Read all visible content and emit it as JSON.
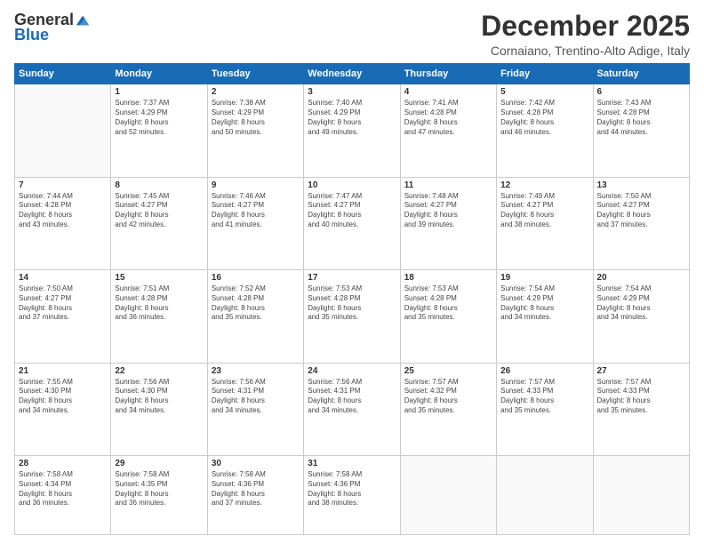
{
  "logo": {
    "general": "General",
    "blue": "Blue"
  },
  "title": "December 2025",
  "location": "Cornaiano, Trentino-Alto Adige, Italy",
  "days_header": [
    "Sunday",
    "Monday",
    "Tuesday",
    "Wednesday",
    "Thursday",
    "Friday",
    "Saturday"
  ],
  "weeks": [
    [
      {
        "day": "",
        "info": ""
      },
      {
        "day": "1",
        "info": "Sunrise: 7:37 AM\nSunset: 4:29 PM\nDaylight: 8 hours\nand 52 minutes."
      },
      {
        "day": "2",
        "info": "Sunrise: 7:38 AM\nSunset: 4:29 PM\nDaylight: 8 hours\nand 50 minutes."
      },
      {
        "day": "3",
        "info": "Sunrise: 7:40 AM\nSunset: 4:29 PM\nDaylight: 8 hours\nand 49 minutes."
      },
      {
        "day": "4",
        "info": "Sunrise: 7:41 AM\nSunset: 4:28 PM\nDaylight: 8 hours\nand 47 minutes."
      },
      {
        "day": "5",
        "info": "Sunrise: 7:42 AM\nSunset: 4:28 PM\nDaylight: 8 hours\nand 46 minutes."
      },
      {
        "day": "6",
        "info": "Sunrise: 7:43 AM\nSunset: 4:28 PM\nDaylight: 8 hours\nand 44 minutes."
      }
    ],
    [
      {
        "day": "7",
        "info": "Sunrise: 7:44 AM\nSunset: 4:28 PM\nDaylight: 8 hours\nand 43 minutes."
      },
      {
        "day": "8",
        "info": "Sunrise: 7:45 AM\nSunset: 4:27 PM\nDaylight: 8 hours\nand 42 minutes."
      },
      {
        "day": "9",
        "info": "Sunrise: 7:46 AM\nSunset: 4:27 PM\nDaylight: 8 hours\nand 41 minutes."
      },
      {
        "day": "10",
        "info": "Sunrise: 7:47 AM\nSunset: 4:27 PM\nDaylight: 8 hours\nand 40 minutes."
      },
      {
        "day": "11",
        "info": "Sunrise: 7:48 AM\nSunset: 4:27 PM\nDaylight: 8 hours\nand 39 minutes."
      },
      {
        "day": "12",
        "info": "Sunrise: 7:49 AM\nSunset: 4:27 PM\nDaylight: 8 hours\nand 38 minutes."
      },
      {
        "day": "13",
        "info": "Sunrise: 7:50 AM\nSunset: 4:27 PM\nDaylight: 8 hours\nand 37 minutes."
      }
    ],
    [
      {
        "day": "14",
        "info": "Sunrise: 7:50 AM\nSunset: 4:27 PM\nDaylight: 8 hours\nand 37 minutes."
      },
      {
        "day": "15",
        "info": "Sunrise: 7:51 AM\nSunset: 4:28 PM\nDaylight: 8 hours\nand 36 minutes."
      },
      {
        "day": "16",
        "info": "Sunrise: 7:52 AM\nSunset: 4:28 PM\nDaylight: 8 hours\nand 35 minutes."
      },
      {
        "day": "17",
        "info": "Sunrise: 7:53 AM\nSunset: 4:28 PM\nDaylight: 8 hours\nand 35 minutes."
      },
      {
        "day": "18",
        "info": "Sunrise: 7:53 AM\nSunset: 4:28 PM\nDaylight: 8 hours\nand 35 minutes."
      },
      {
        "day": "19",
        "info": "Sunrise: 7:54 AM\nSunset: 4:29 PM\nDaylight: 8 hours\nand 34 minutes."
      },
      {
        "day": "20",
        "info": "Sunrise: 7:54 AM\nSunset: 4:29 PM\nDaylight: 8 hours\nand 34 minutes."
      }
    ],
    [
      {
        "day": "21",
        "info": "Sunrise: 7:55 AM\nSunset: 4:30 PM\nDaylight: 8 hours\nand 34 minutes."
      },
      {
        "day": "22",
        "info": "Sunrise: 7:56 AM\nSunset: 4:30 PM\nDaylight: 8 hours\nand 34 minutes."
      },
      {
        "day": "23",
        "info": "Sunrise: 7:56 AM\nSunset: 4:31 PM\nDaylight: 8 hours\nand 34 minutes."
      },
      {
        "day": "24",
        "info": "Sunrise: 7:56 AM\nSunset: 4:31 PM\nDaylight: 8 hours\nand 34 minutes."
      },
      {
        "day": "25",
        "info": "Sunrise: 7:57 AM\nSunset: 4:32 PM\nDaylight: 8 hours\nand 35 minutes."
      },
      {
        "day": "26",
        "info": "Sunrise: 7:57 AM\nSunset: 4:33 PM\nDaylight: 8 hours\nand 35 minutes."
      },
      {
        "day": "27",
        "info": "Sunrise: 7:57 AM\nSunset: 4:33 PM\nDaylight: 8 hours\nand 35 minutes."
      }
    ],
    [
      {
        "day": "28",
        "info": "Sunrise: 7:58 AM\nSunset: 4:34 PM\nDaylight: 8 hours\nand 36 minutes."
      },
      {
        "day": "29",
        "info": "Sunrise: 7:58 AM\nSunset: 4:35 PM\nDaylight: 8 hours\nand 36 minutes."
      },
      {
        "day": "30",
        "info": "Sunrise: 7:58 AM\nSunset: 4:36 PM\nDaylight: 8 hours\nand 37 minutes."
      },
      {
        "day": "31",
        "info": "Sunrise: 7:58 AM\nSunset: 4:36 PM\nDaylight: 8 hours\nand 38 minutes."
      },
      {
        "day": "",
        "info": ""
      },
      {
        "day": "",
        "info": ""
      },
      {
        "day": "",
        "info": ""
      }
    ]
  ]
}
